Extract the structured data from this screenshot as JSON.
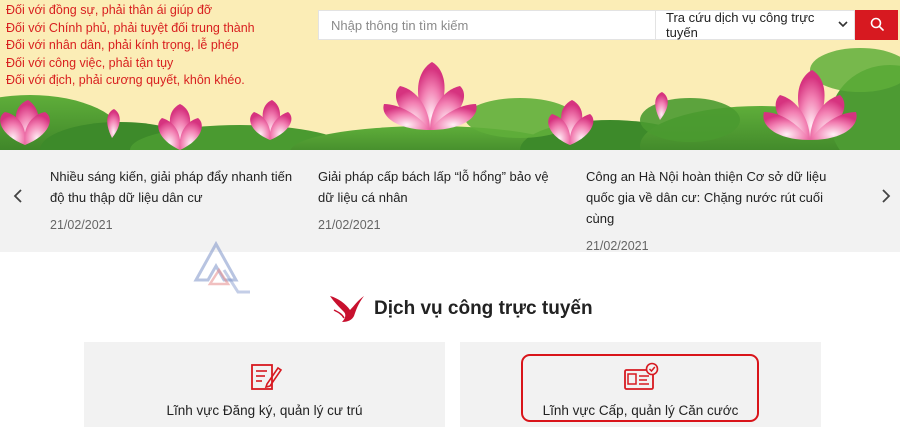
{
  "banner": {
    "mottos": [
      "Đối với đồng sự, phải thân ái giúp đỡ",
      "Đối với Chính phủ, phải tuyệt đối trung thành",
      "Đối với nhân dân, phải kính trọng, lễ phép",
      "Đối với công việc, phải tận tụy",
      "Đối với địch, phải cương quyết, khôn khéo."
    ]
  },
  "search": {
    "placeholder": "Nhập thông tin tìm kiếm",
    "select_value": "Tra cứu dịch vụ công trực tuyến"
  },
  "news": [
    {
      "title": "Nhiều sáng kiến, giải pháp đẩy nhanh tiến độ thu thập dữ liệu dân cư",
      "date": "21/02/2021"
    },
    {
      "title": "Giải pháp cấp bách lấp “lỗ hổng” bảo vệ dữ liệu cá nhân",
      "date": "21/02/2021"
    },
    {
      "title": "Công an Hà Nội hoàn thiện Cơ sở dữ liệu quốc gia về dân cư: Chặng nước rút cuối cùng",
      "date": "21/02/2021"
    }
  ],
  "section": {
    "title": "Dịch vụ công trực tuyến"
  },
  "services": [
    {
      "label": "Lĩnh vực Đăng ký, quản lý cư trú",
      "icon": "edit-document-icon"
    },
    {
      "label": "Lĩnh vực Cấp, quản lý Căn cước",
      "icon": "id-card-icon"
    }
  ],
  "colors": {
    "accent": "#d71920",
    "banner_bg": "#fbedb6",
    "motto_text": "#d81f1f",
    "news_bg": "#f2f2f2"
  }
}
